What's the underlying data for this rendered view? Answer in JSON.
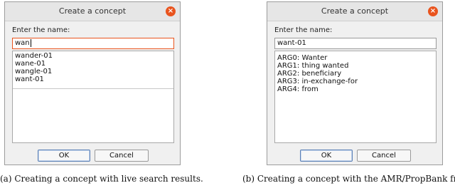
{
  "dialog_a": {
    "title": "Create a concept",
    "close_glyph": "×",
    "prompt": "Enter the name:",
    "input_value": "wan",
    "results": [
      "wander-01",
      "wane-01",
      "wangle-01",
      "want-01"
    ],
    "ok_label": "OK",
    "cancel_label": "Cancel"
  },
  "dialog_b": {
    "title": "Create a concept",
    "close_glyph": "×",
    "prompt": "Enter the name:",
    "input_value": "want-01",
    "frame_args": [
      "ARG0: Wanter",
      "ARG1: thing wanted",
      "ARG2: beneficiary",
      "ARG3: in-exchange-for",
      "ARG4: from"
    ],
    "ok_label": "OK",
    "cancel_label": "Cancel"
  },
  "captions": {
    "a": "(a) Creating a concept with live search results.",
    "b": "(b) Creating a concept with the AMR/PropBank fram"
  },
  "colors": {
    "accent": "#e9541e",
    "dialog_bg": "#f0f0f0"
  }
}
